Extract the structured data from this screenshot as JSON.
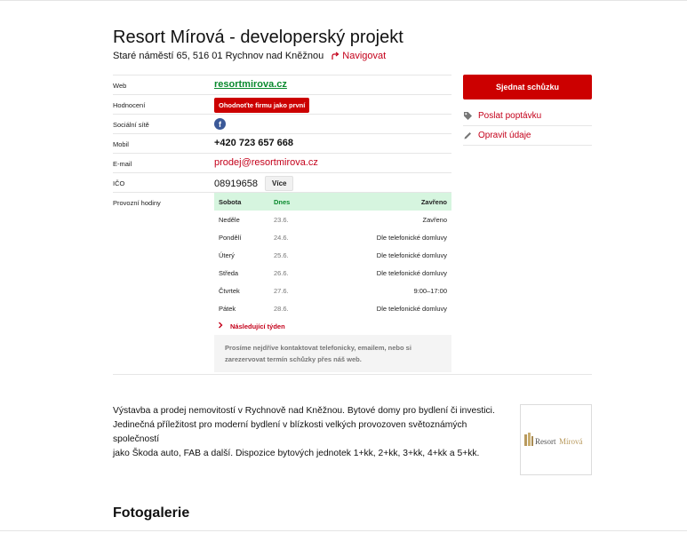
{
  "header": {
    "title": "Resort Mírová - developerský projekt",
    "address": "Staré náměstí 65, 516 01 Rychnov nad Kněžnou",
    "navigate_label": "Navigovat"
  },
  "info": {
    "web_label": "Web",
    "web_value": "resortmirova.cz",
    "rating_label": "Hodnocení",
    "rating_button": "Ohodnoťte firmu jako první",
    "social_label": "Sociální sítě",
    "mobile_label": "Mobil",
    "mobile_value": "+420 723 657 668",
    "email_label": "E-mail",
    "email_value": "prodej@resortmirova.cz",
    "ico_label": "IČO",
    "ico_value": "08919658",
    "more_button": "Více",
    "hours_label": "Provozní hodiny"
  },
  "hours": {
    "rows": [
      {
        "day": "Sobota",
        "date": "Dnes",
        "state": "Zavřeno"
      },
      {
        "day": "Neděle",
        "date": "23.6.",
        "state": "Zavřeno"
      },
      {
        "day": "Pondělí",
        "date": "24.6.",
        "state": "Dle telefonické domluvy"
      },
      {
        "day": "Úterý",
        "date": "25.6.",
        "state": "Dle telefonické domluvy"
      },
      {
        "day": "Středa",
        "date": "26.6.",
        "state": "Dle telefonické domluvy"
      },
      {
        "day": "Čtvrtek",
        "date": "27.6.",
        "state": "9:00–17:00"
      },
      {
        "day": "Pátek",
        "date": "28.6.",
        "state": "Dle telefonické domluvy"
      }
    ],
    "next_week": "Následující týden",
    "note_line1": "Prosíme nejdříve kontaktovat telefonicky, emailem, nebo si",
    "note_line2": "zarezervovat termín schůzky přes náš web."
  },
  "side": {
    "cta": "Sjednat schůzku",
    "inquiry": "Poslat poptávku",
    "edit": "Opravit údaje"
  },
  "description": {
    "line1": "Výstavba a prodej nemovitostí v Rychnově nad Kněžnou. Bytové domy pro bydlení či investici.",
    "line2": "Jedinečná příležitost pro moderní bydlení v blízkosti velkých provozoven světoznámých společností",
    "line3": "jako Škoda auto, FAB a další. Dispozice bytových jednotek 1+kk, 2+kk, 3+kk, 4+kk a 5+kk."
  },
  "logo": {
    "text_a": "Resort",
    "text_b": "Mírová"
  },
  "gallery": {
    "title": "Fotogalerie"
  },
  "colors": {
    "accent": "#cc0000",
    "link_red": "#c4001a",
    "link_green": "#0a8a2e",
    "today_bg": "#d6f5df",
    "facebook": "#3b5998"
  }
}
